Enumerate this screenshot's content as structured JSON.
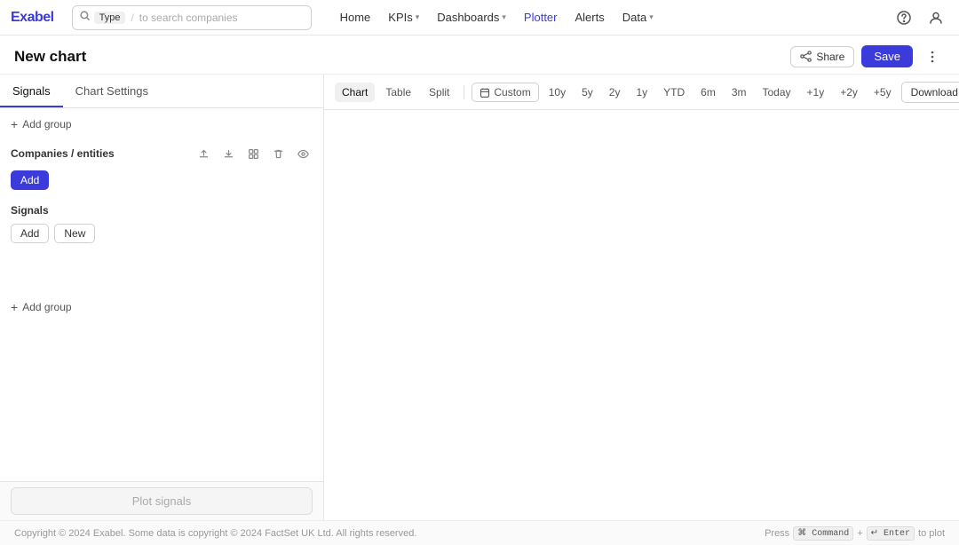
{
  "logo": "Exabel",
  "nav": {
    "search": {
      "tag": "Type",
      "divider": "/",
      "placeholder": "to search companies"
    },
    "links": [
      {
        "label": "Home",
        "hasChevron": false
      },
      {
        "label": "KPIs",
        "hasChevron": true
      },
      {
        "label": "Dashboards",
        "hasChevron": true
      },
      {
        "label": "Plotter",
        "hasChevron": false
      },
      {
        "label": "Alerts",
        "hasChevron": false
      },
      {
        "label": "Data",
        "hasChevron": true
      }
    ]
  },
  "pageTitle": "New chart",
  "actions": {
    "share": "Share",
    "save": "Save"
  },
  "leftPanel": {
    "tabs": [
      {
        "label": "Signals",
        "active": true
      },
      {
        "label": "Chart Settings",
        "active": false
      }
    ],
    "addGroupLabel": "Add group",
    "companiesSection": {
      "title": "Companies / entities",
      "icons": [
        "upload",
        "download",
        "grid",
        "trash",
        "eye"
      ]
    },
    "addButton": "Add",
    "signalsSection": {
      "title": "Signals",
      "addButton": "Add",
      "newButton": "New"
    }
  },
  "rightPanel": {
    "tabs": [
      {
        "label": "Chart",
        "active": true
      },
      {
        "label": "Table",
        "active": false
      },
      {
        "label": "Split",
        "active": false
      }
    ],
    "customBtn": "Custom",
    "timePeriods": [
      "10y",
      "5y",
      "2y",
      "1y",
      "YTD",
      "6m",
      "3m",
      "Today",
      "+1y",
      "+2y",
      "+5y"
    ],
    "downloadBtn": "Download"
  },
  "plotSignals": {
    "buttonLabel": "Plot signals"
  },
  "footer": {
    "copyright": "Copyright © 2024 Exabel. Some data is copyright © 2024 FactSet UK Ltd. All rights reserved.",
    "shortcut": {
      "prefix": "Press",
      "key1": "⌘ Command",
      "plus": "+",
      "key2": "↵ Enter",
      "suffix": "to plot"
    }
  }
}
